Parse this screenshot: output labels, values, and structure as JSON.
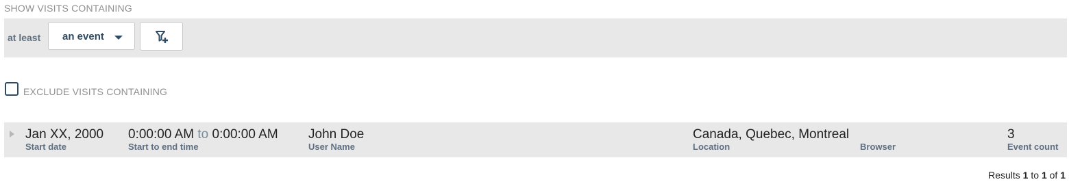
{
  "include_filter": {
    "title": "SHOW VISITS CONTAINING",
    "quantifier_label": "at least",
    "event_dropdown": {
      "selected": "an event",
      "icon": "caret-down-icon"
    },
    "add_filter_button": {
      "icon": "filter-plus-icon"
    }
  },
  "exclude_filter": {
    "label": "EXCLUDE VISITS CONTAINING",
    "checked": false
  },
  "visits": [
    {
      "start_date": {
        "value": "Jan XX, 2000",
        "label": "Start date"
      },
      "time": {
        "start": "0:00:00 AM",
        "connector": "to",
        "end": "0:00:00 AM",
        "label": "Start to end time"
      },
      "user_name": {
        "value": "John Doe",
        "label": "User Name"
      },
      "location": {
        "value": "Canada, Quebec, Montreal",
        "label": "Location"
      },
      "browser": {
        "value": "",
        "label": "Browser"
      },
      "event_count": {
        "value": "3",
        "label": "Event count"
      }
    }
  ],
  "pagination": {
    "prefix": "Results",
    "from": "1",
    "to_word": "to",
    "to": "1",
    "of_word": "of",
    "total": "1"
  },
  "colors": {
    "accent": "#2f4a63",
    "label": "#5f6f80",
    "panel": "#e8e8e8",
    "muted": "#8f8f8f"
  }
}
